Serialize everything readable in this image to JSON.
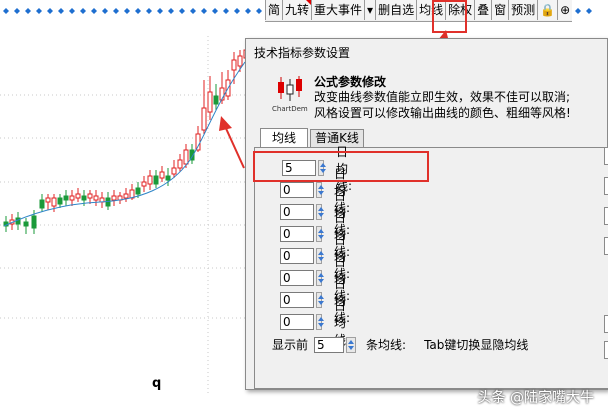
{
  "toolbar": {
    "items": [
      {
        "label": "简",
        "marked": false
      },
      {
        "label": "九转",
        "marked": true
      },
      {
        "label": "重大事件",
        "marked": false
      },
      {
        "label": "▾",
        "marked": false
      },
      {
        "label": "删自选",
        "marked": false
      },
      {
        "label": "均线",
        "marked": false
      },
      {
        "label": "除权",
        "marked": false
      },
      {
        "label": "叠",
        "marked": false
      },
      {
        "label": "窗",
        "marked": false
      },
      {
        "label": "预测",
        "marked": false
      },
      {
        "label": "🔒",
        "marked": false
      },
      {
        "label": "⊕",
        "marked": false
      }
    ]
  },
  "dialog": {
    "title": "技术指标参数设置",
    "logo_text": "ChartDem",
    "heading": "公式参数修改",
    "line1": "改变曲线参数值能立即生效，效果不佳可以取消;",
    "line2": "风格设置可以修改输出曲线的颜色、粗细等风格!",
    "tabs": [
      "均线",
      "普通K线"
    ],
    "ma_rows": [
      {
        "value": "5",
        "label": "日均线:"
      },
      {
        "value": "0",
        "label": "日均线:"
      },
      {
        "value": "0",
        "label": "日均线:"
      },
      {
        "value": "0",
        "label": "日均线:"
      },
      {
        "value": "0",
        "label": "日均线:"
      },
      {
        "value": "0",
        "label": "日均线:"
      },
      {
        "value": "0",
        "label": "日均线:"
      },
      {
        "value": "0",
        "label": "日均线:"
      }
    ],
    "bottom": {
      "prefix": "显示前",
      "value": "5",
      "suffix": "条均线:",
      "hint": "Tab键切换显隐均线"
    }
  },
  "chart_label": "q",
  "watermark": "头条 @陆家嘴大牛",
  "colors": {
    "up": "#e02020",
    "down": "#1a9a3a",
    "ma_line": "#2f86c8",
    "grid_dot": "#1e6fd0",
    "annotation": "#e0302a"
  }
}
